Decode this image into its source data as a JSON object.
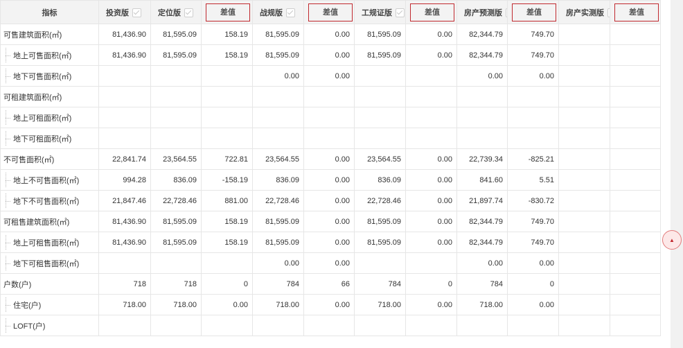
{
  "header": {
    "index_label": "指标",
    "versions": [
      {
        "label": "投资版",
        "checked": true
      },
      {
        "label": "定位版",
        "checked": true
      },
      {
        "label": "战规版",
        "checked": true
      },
      {
        "label": "工规证版",
        "checked": true
      },
      {
        "label": "房产预测版",
        "checked": true
      },
      {
        "label": "房产实测版",
        "checked": false
      }
    ],
    "diff_label": "差值"
  },
  "rows": [
    {
      "label": "可售建筑面积(㎡)",
      "child": false,
      "values": [
        "81,436.90",
        "81,595.09",
        "158.19",
        "81,595.09",
        "0.00",
        "81,595.09",
        "0.00",
        "82,344.79",
        "749.70",
        "",
        ""
      ]
    },
    {
      "label": "地上可售面积(㎡)",
      "child": true,
      "values": [
        "81,436.90",
        "81,595.09",
        "158.19",
        "81,595.09",
        "0.00",
        "81,595.09",
        "0.00",
        "82,344.79",
        "749.70",
        "",
        ""
      ]
    },
    {
      "label": "地下可售面积(㎡)",
      "child": true,
      "values": [
        "",
        "",
        "",
        "0.00",
        "0.00",
        "",
        "",
        "0.00",
        "0.00",
        "",
        ""
      ]
    },
    {
      "label": "可租建筑面积(㎡)",
      "child": false,
      "values": [
        "",
        "",
        "",
        "",
        "",
        "",
        "",
        "",
        "",
        "",
        ""
      ]
    },
    {
      "label": "地上可租面积(㎡)",
      "child": true,
      "values": [
        "",
        "",
        "",
        "",
        "",
        "",
        "",
        "",
        "",
        "",
        ""
      ]
    },
    {
      "label": "地下可租面积(㎡)",
      "child": true,
      "values": [
        "",
        "",
        "",
        "",
        "",
        "",
        "",
        "",
        "",
        "",
        ""
      ]
    },
    {
      "label": "不可售面积(㎡)",
      "child": false,
      "values": [
        "22,841.74",
        "23,564.55",
        "722.81",
        "23,564.55",
        "0.00",
        "23,564.55",
        "0.00",
        "22,739.34",
        "-825.21",
        "",
        ""
      ]
    },
    {
      "label": "地上不可售面积(㎡)",
      "child": true,
      "values": [
        "994.28",
        "836.09",
        "-158.19",
        "836.09",
        "0.00",
        "836.09",
        "0.00",
        "841.60",
        "5.51",
        "",
        ""
      ]
    },
    {
      "label": "地下不可售面积(㎡)",
      "child": true,
      "values": [
        "21,847.46",
        "22,728.46",
        "881.00",
        "22,728.46",
        "0.00",
        "22,728.46",
        "0.00",
        "21,897.74",
        "-830.72",
        "",
        ""
      ]
    },
    {
      "label": "可租售建筑面积(㎡)",
      "child": false,
      "values": [
        "81,436.90",
        "81,595.09",
        "158.19",
        "81,595.09",
        "0.00",
        "81,595.09",
        "0.00",
        "82,344.79",
        "749.70",
        "",
        ""
      ]
    },
    {
      "label": "地上可租售面积(㎡)",
      "child": true,
      "values": [
        "81,436.90",
        "81,595.09",
        "158.19",
        "81,595.09",
        "0.00",
        "81,595.09",
        "0.00",
        "82,344.79",
        "749.70",
        "",
        ""
      ]
    },
    {
      "label": "地下可租售面积(㎡)",
      "child": true,
      "values": [
        "",
        "",
        "",
        "0.00",
        "0.00",
        "",
        "",
        "0.00",
        "0.00",
        "",
        ""
      ]
    },
    {
      "label": "户数(户)",
      "child": false,
      "values": [
        "718",
        "718",
        "0",
        "784",
        "66",
        "784",
        "0",
        "784",
        "0",
        "",
        ""
      ]
    },
    {
      "label": "住宅(户)",
      "child": true,
      "values": [
        "718.00",
        "718.00",
        "0.00",
        "718.00",
        "0.00",
        "718.00",
        "0.00",
        "718.00",
        "0.00",
        "",
        ""
      ]
    },
    {
      "label": "LOFT(户)",
      "child": true,
      "values": [
        "",
        "",
        "",
        "",
        "",
        "",
        "",
        "",
        "",
        "",
        ""
      ]
    }
  ],
  "back_to_top_icon": "caret-up-icon",
  "colors": {
    "highlight_border": "#c0282e",
    "header_bg": "#f3f3f3"
  }
}
